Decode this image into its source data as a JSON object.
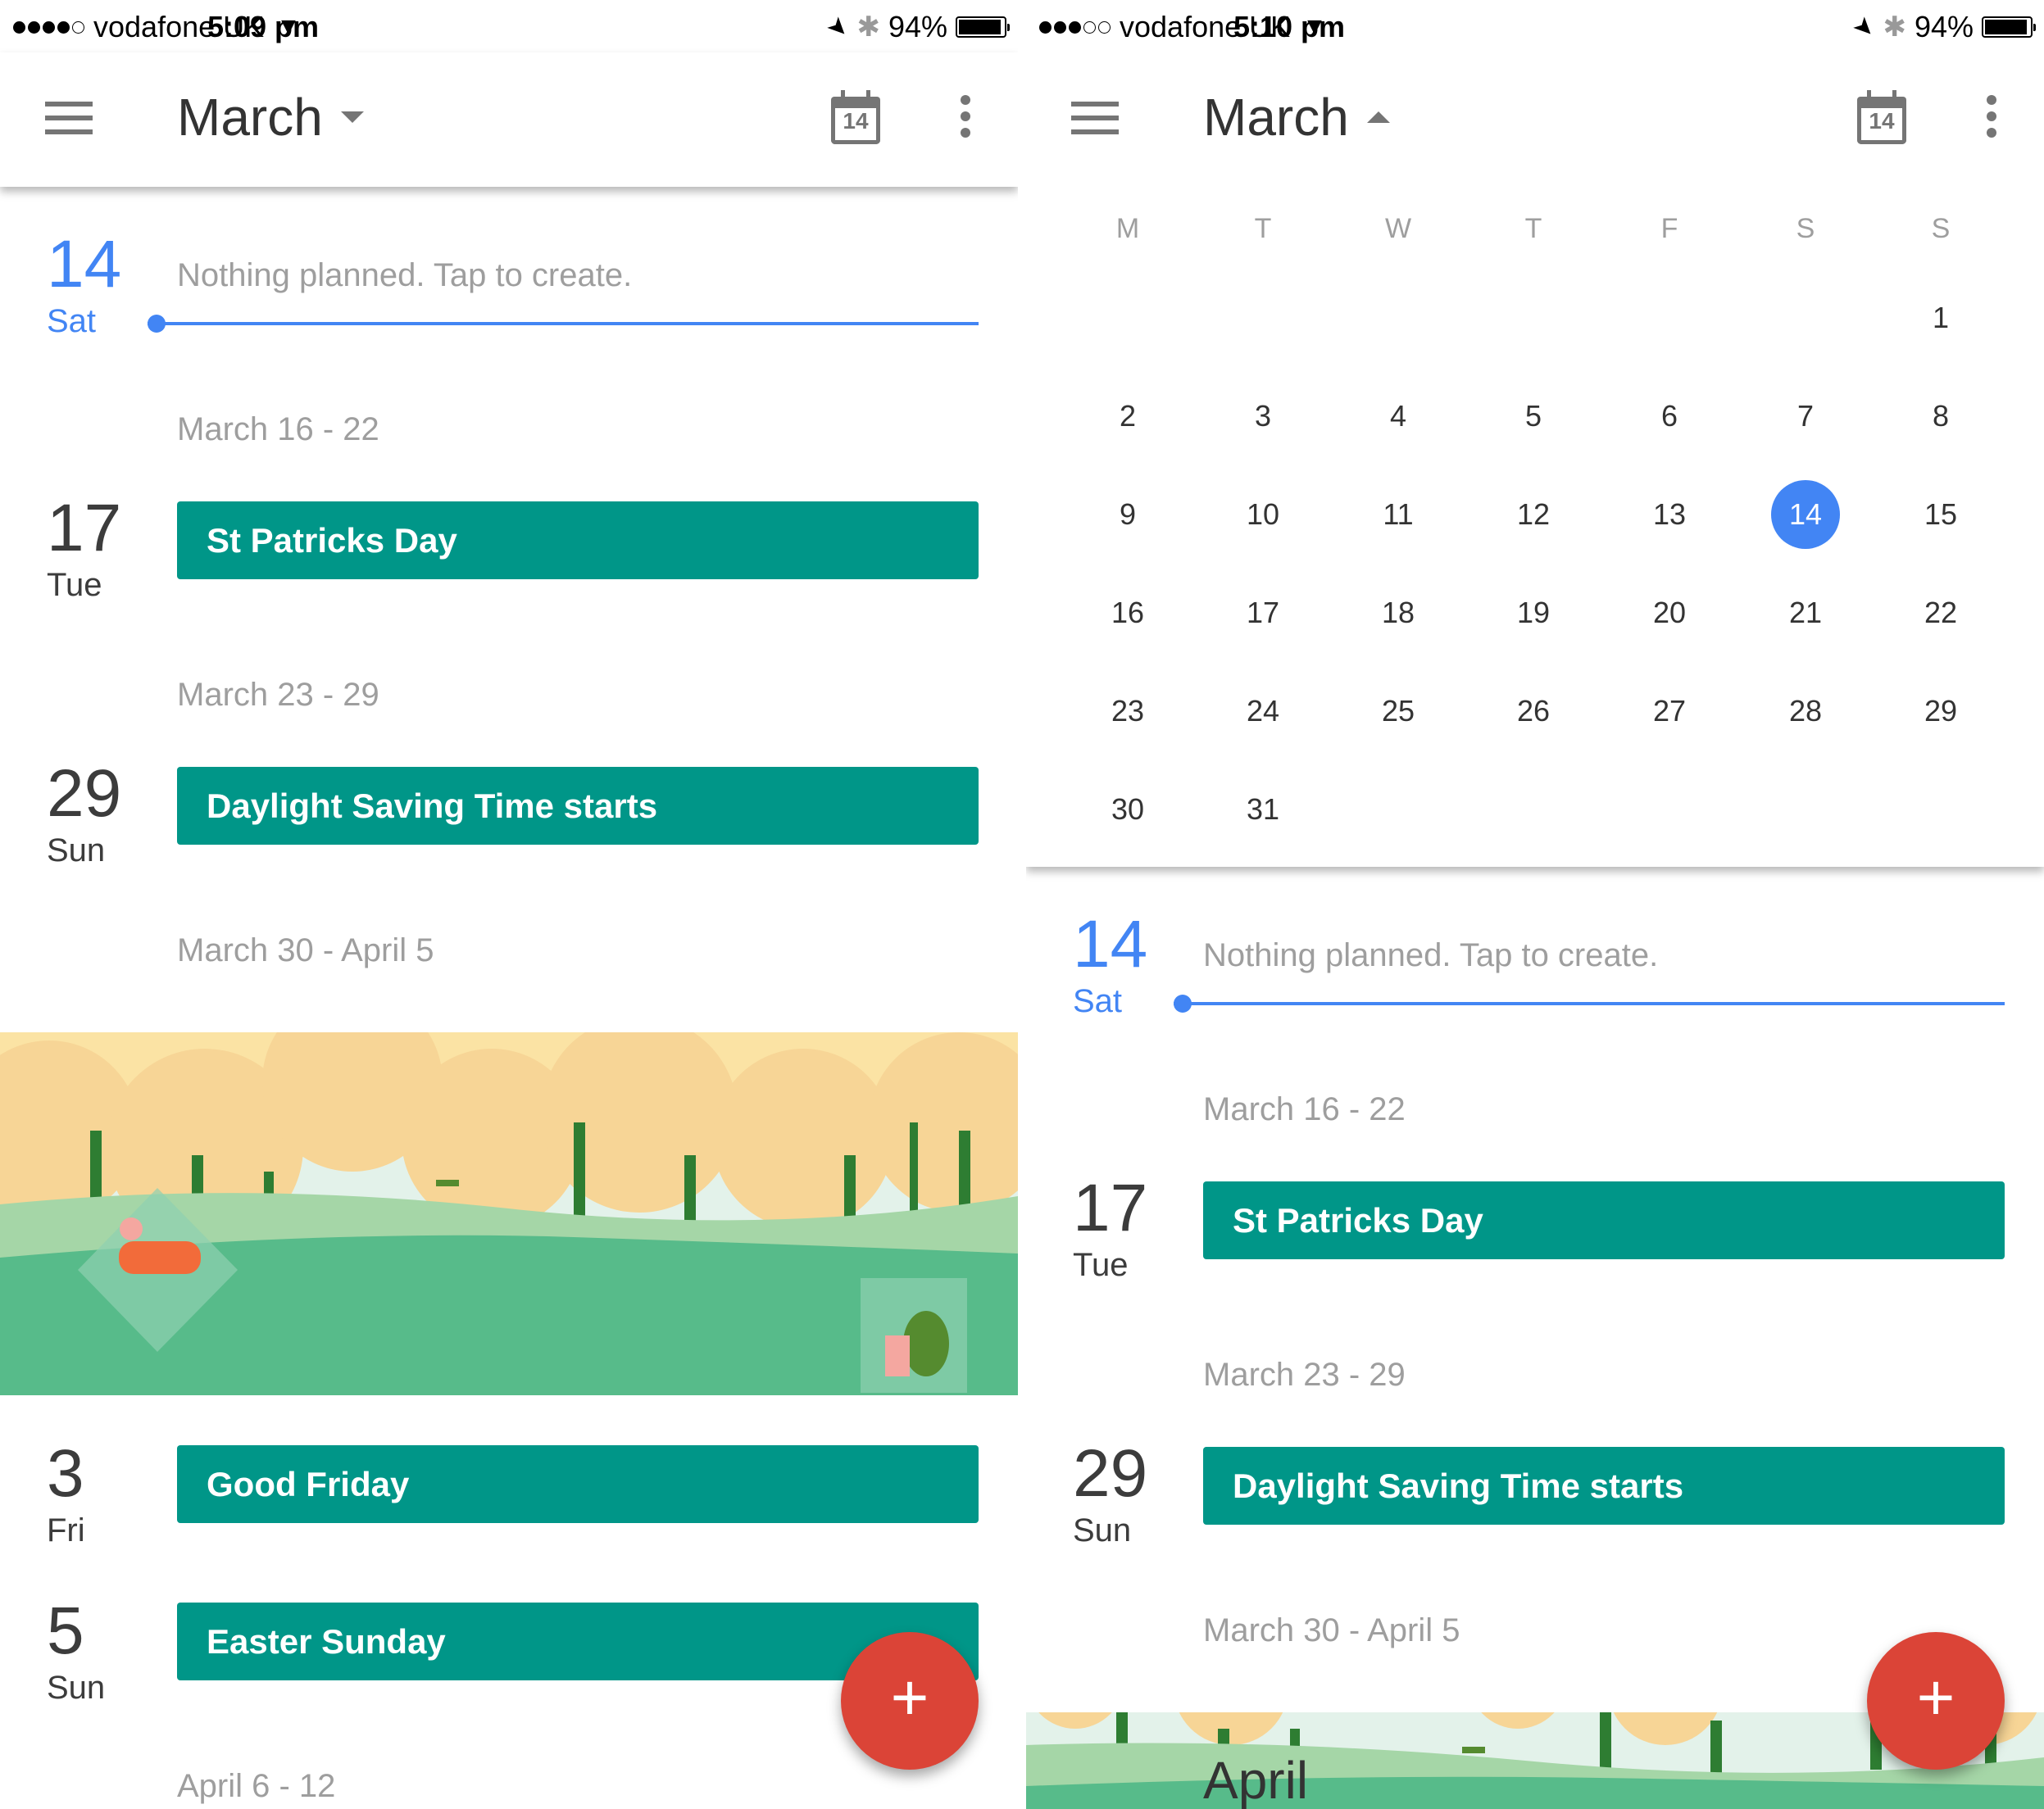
{
  "colors": {
    "accent_blue": "#4285f4",
    "event_teal": "#009688",
    "fab_red": "#db4437",
    "secondary_text": "#9e9e9e",
    "primary_text": "#3c3c3c"
  },
  "screens": [
    {
      "status_bar": {
        "signal_filled": 4,
        "signal_total": 5,
        "carrier": "vodafone UK",
        "wifi_icon": "wifi-icon",
        "time": "5:09 pm",
        "location_icon": "location-arrow-icon",
        "bluetooth_icon": "bluetooth-icon",
        "battery_percent": "94%",
        "battery_level": 0.94
      },
      "app_bar": {
        "menu_icon": "hamburger-menu-icon",
        "title": "March",
        "title_caret": "dropdown-down",
        "today_icon_label": "14",
        "more_icon": "more-vert-icon"
      },
      "agenda": [
        {
          "type": "today",
          "day_num": "14",
          "day_name": "Sat",
          "text": "Nothing planned. Tap to create."
        },
        {
          "type": "week",
          "label": "March 16 - 22"
        },
        {
          "type": "event",
          "day_num": "17",
          "day_name": "Tue",
          "title": "St Patricks Day"
        },
        {
          "type": "week",
          "label": "March 23 - 29"
        },
        {
          "type": "event",
          "day_num": "29",
          "day_name": "Sun",
          "title": "Daylight Saving Time starts"
        },
        {
          "type": "week",
          "label": "March 30 - April 5"
        },
        {
          "type": "illustration",
          "name": "april-park-illustration"
        },
        {
          "type": "event",
          "day_num": "3",
          "day_name": "Fri",
          "title": "Good Friday"
        },
        {
          "type": "event",
          "day_num": "5",
          "day_name": "Sun",
          "title": "Easter Sunday"
        },
        {
          "type": "week",
          "label": "April 6 - 12"
        }
      ],
      "fab_label": "+"
    },
    {
      "status_bar": {
        "signal_filled": 3,
        "signal_total": 5,
        "carrier": "vodafone UK",
        "wifi_icon": "wifi-icon",
        "time": "5:10 pm",
        "location_icon": "location-arrow-icon",
        "bluetooth_icon": "bluetooth-icon",
        "battery_percent": "94%",
        "battery_level": 0.94
      },
      "app_bar": {
        "menu_icon": "hamburger-menu-icon",
        "title": "March",
        "title_caret": "dropdown-up",
        "today_icon_label": "14",
        "more_icon": "more-vert-icon"
      },
      "month_grid": {
        "weekdays": [
          "M",
          "T",
          "W",
          "T",
          "F",
          "S",
          "S"
        ],
        "first_weekday_index": 6,
        "days_in_month": 31,
        "selected_day": 14
      },
      "agenda": [
        {
          "type": "today",
          "day_num": "14",
          "day_name": "Sat",
          "text": "Nothing planned. Tap to create."
        },
        {
          "type": "week",
          "label": "March 16 - 22"
        },
        {
          "type": "event",
          "day_num": "17",
          "day_name": "Tue",
          "title": "St Patricks Day"
        },
        {
          "type": "week",
          "label": "March 23 - 29"
        },
        {
          "type": "event",
          "day_num": "29",
          "day_name": "Sun",
          "title": "Daylight Saving Time starts"
        },
        {
          "type": "week",
          "label": "March 30 - April 5"
        },
        {
          "type": "month_banner",
          "label": "April"
        }
      ],
      "fab_label": "+"
    }
  ]
}
